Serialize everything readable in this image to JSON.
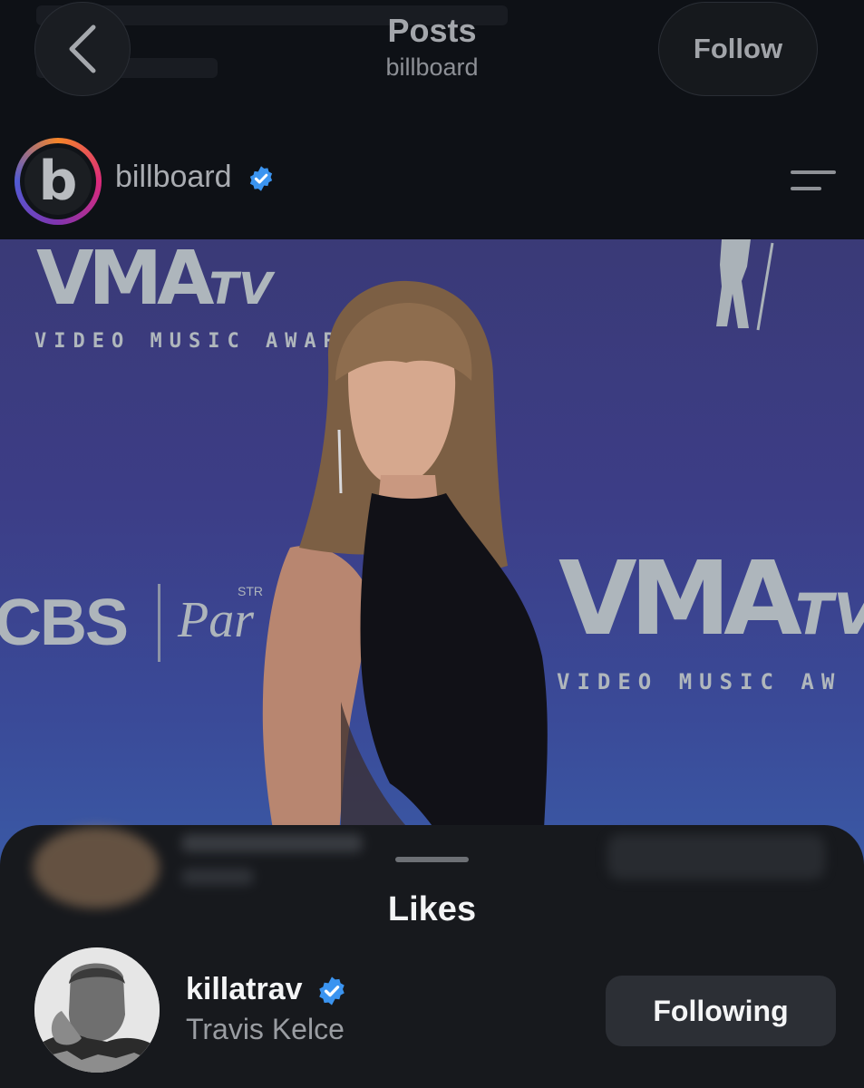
{
  "header": {
    "title": "Posts",
    "subtitle": "billboard",
    "follow_label": "Follow",
    "back_icon": "chevron-left-icon"
  },
  "post": {
    "account": "billboard",
    "verified": true,
    "menu_icon": "menu-icon",
    "photo": {
      "wordmark_vma": "VMA",
      "wordmark_tv": "TV",
      "backdrop_text": "VIDEO MUSIC AWARDS",
      "backdrop_text_cropped": "VIDEO MUSIC AW",
      "sponsor_cbs": "CBS",
      "sponsor_paramount": "Par",
      "sponsor_paramount_small": "STR"
    }
  },
  "likes_sheet": {
    "title": "Likes",
    "likers": [
      {
        "username": "killatrav",
        "full_name": "Travis Kelce",
        "verified": true,
        "button_label": "Following"
      }
    ]
  },
  "colors": {
    "background": "#101318",
    "sheet": "#17191d",
    "verified": "#3b94f0",
    "following_button": "#2c2f35"
  }
}
